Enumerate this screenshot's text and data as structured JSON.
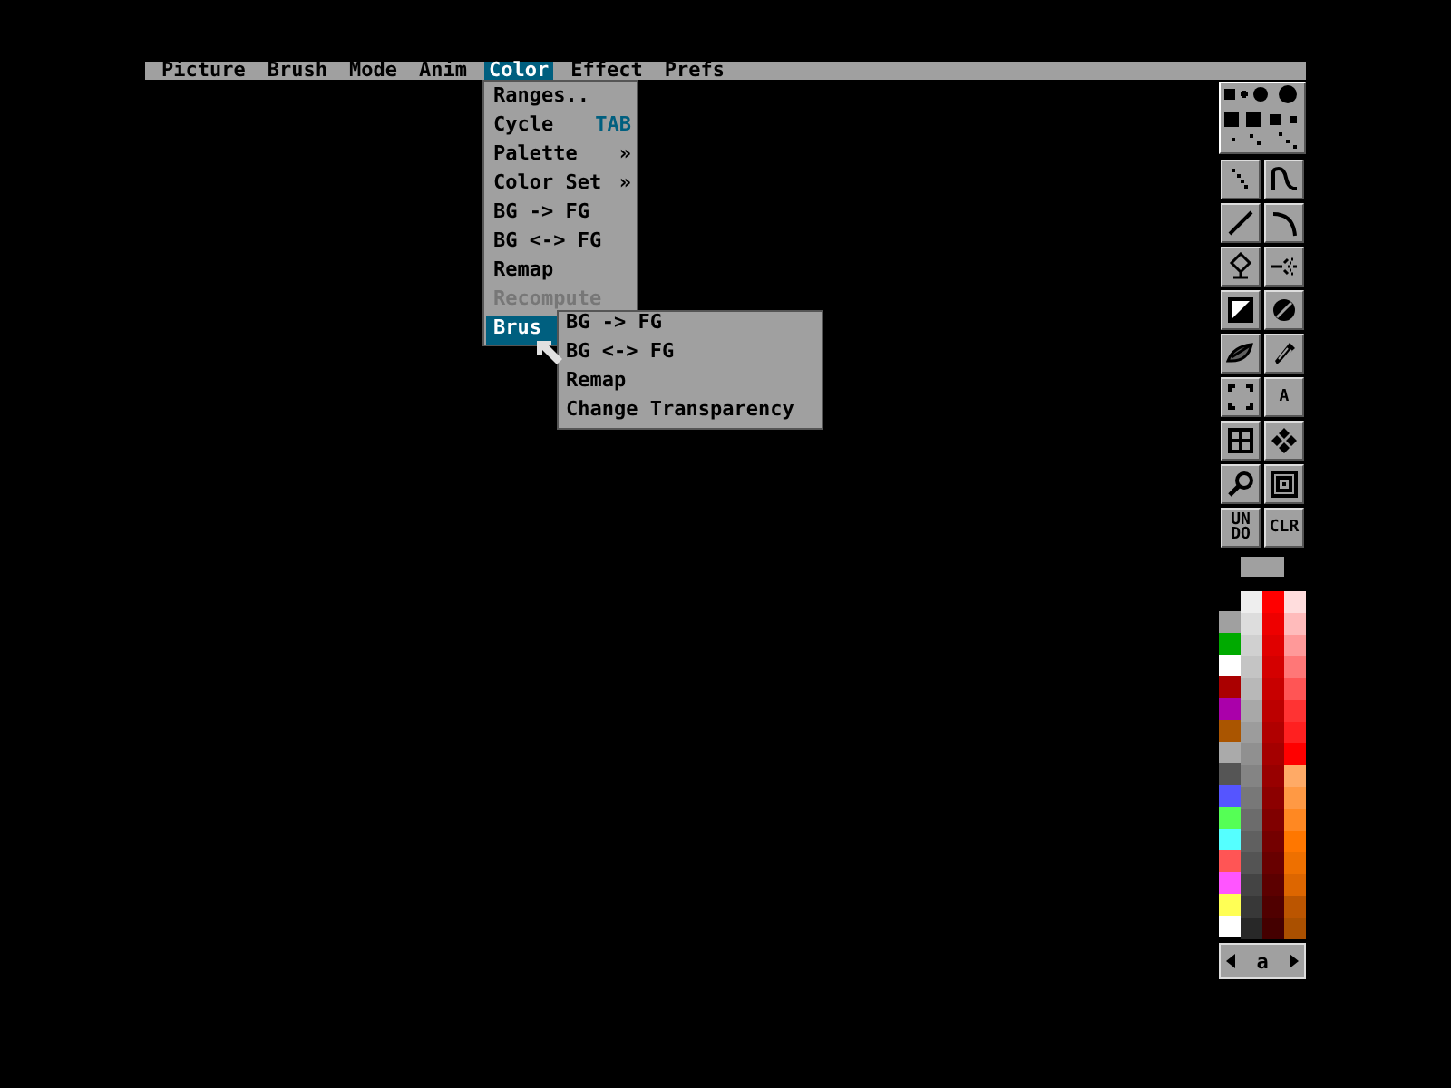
{
  "menu_bar": [
    {
      "label": "Picture",
      "selected": false
    },
    {
      "label": "Brush",
      "selected": false
    },
    {
      "label": "Mode",
      "selected": false
    },
    {
      "label": "Anim",
      "selected": false
    },
    {
      "label": "Color",
      "selected": true
    },
    {
      "label": "Effect",
      "selected": false
    },
    {
      "label": "Prefs",
      "selected": false
    }
  ],
  "color_menu": [
    {
      "label": "Ranges..",
      "selected": false,
      "disabled": false
    },
    {
      "label": "Cycle",
      "shortcut": "TAB",
      "selected": false,
      "disabled": false
    },
    {
      "label": "Palette",
      "shortcut": "»",
      "selected": false,
      "disabled": false
    },
    {
      "label": "Color Set",
      "shortcut": "»",
      "selected": false,
      "disabled": false
    },
    {
      "label": "BG -> FG",
      "selected": false,
      "disabled": false
    },
    {
      "label": "BG <-> FG",
      "selected": false,
      "disabled": false
    },
    {
      "label": "Remap",
      "selected": false,
      "disabled": false
    },
    {
      "label": "Recompute",
      "selected": false,
      "disabled": true
    },
    {
      "label": "Brus",
      "selected": true,
      "disabled": false
    }
  ],
  "brush_submenu": [
    "BG -> FG",
    "BG <-> FG",
    "Remap",
    "Change Transparency"
  ],
  "tools": [
    {
      "kind": "dots"
    },
    {
      "kind": "curve"
    },
    {
      "kind": "line"
    },
    {
      "kind": "arc"
    },
    {
      "kind": "balloon"
    },
    {
      "kind": "spray"
    },
    {
      "kind": "rect"
    },
    {
      "kind": "ellipse"
    },
    {
      "kind": "lasso"
    },
    {
      "kind": "hatch"
    },
    {
      "kind": "grab"
    },
    {
      "kind": "text",
      "label": "A"
    },
    {
      "kind": "grid"
    },
    {
      "kind": "move"
    },
    {
      "kind": "magnify"
    },
    {
      "kind": "frame"
    },
    {
      "kind": "text",
      "label": "UN DO"
    },
    {
      "kind": "text",
      "label": "CLR"
    }
  ],
  "palette": {
    "side": [
      {
        "color": "#a0a0a0"
      },
      {
        "color": "#00aa00"
      },
      {
        "color": "#ffffff"
      },
      {
        "color": "#aa0000"
      },
      {
        "color": "#aa00aa"
      },
      {
        "color": "#aa5500"
      },
      {
        "color": "#aaaaaa"
      },
      {
        "color": "#555555"
      },
      {
        "color": "#5555ff"
      },
      {
        "color": "#55ff55"
      },
      {
        "color": "#55ffff"
      },
      {
        "color": "#ff5555"
      },
      {
        "color": "#ff55ff"
      },
      {
        "color": "#ffff55"
      },
      {
        "color": "#ffffff"
      }
    ],
    "columns": [
      {
        "swatches": [
          {
            "color": "#eeeeee"
          },
          {
            "color": "#dddddd"
          },
          {
            "color": "#d0d0d0"
          },
          {
            "color": "#c4c4c4"
          },
          {
            "color": "#b8b8b8"
          },
          {
            "color": "#a8a8a8"
          },
          {
            "color": "#9c9c9c"
          },
          {
            "color": "#909090"
          },
          {
            "color": "#848484"
          },
          {
            "color": "#787878"
          },
          {
            "color": "#6c6c6c"
          },
          {
            "color": "#606060"
          },
          {
            "color": "#545454"
          },
          {
            "color": "#444444"
          },
          {
            "color": "#383838"
          },
          {
            "color": "#282828"
          }
        ]
      },
      {
        "swatches": [
          {
            "color": "#ff0000"
          },
          {
            "color": "#ee0000"
          },
          {
            "color": "#e00000"
          },
          {
            "color": "#d40000"
          },
          {
            "color": "#c80000"
          },
          {
            "color": "#bc0000"
          },
          {
            "color": "#b00000"
          },
          {
            "color": "#a40000"
          },
          {
            "color": "#980000"
          },
          {
            "color": "#8c0000"
          },
          {
            "color": "#800000"
          },
          {
            "color": "#740000"
          },
          {
            "color": "#680000"
          },
          {
            "color": "#5c0000"
          },
          {
            "color": "#500000"
          },
          {
            "color": "#440000"
          }
        ]
      },
      {
        "swatches": [
          {
            "color": "#ffdddd"
          },
          {
            "color": "#ffbbbb"
          },
          {
            "color": "#ff9999"
          },
          {
            "color": "#ff7777"
          },
          {
            "color": "#ff5555"
          },
          {
            "color": "#ff3333"
          },
          {
            "color": "#ff2020"
          },
          {
            "color": "#ff0000"
          },
          {
            "color": "#ffaa66"
          },
          {
            "color": "#ff9944"
          },
          {
            "color": "#ff8822"
          },
          {
            "color": "#ff7700"
          },
          {
            "color": "#ee7000"
          },
          {
            "color": "#dd6600"
          },
          {
            "color": "#bb5500"
          },
          {
            "color": "#aa5000"
          }
        ]
      }
    ]
  },
  "palette_page": "a"
}
